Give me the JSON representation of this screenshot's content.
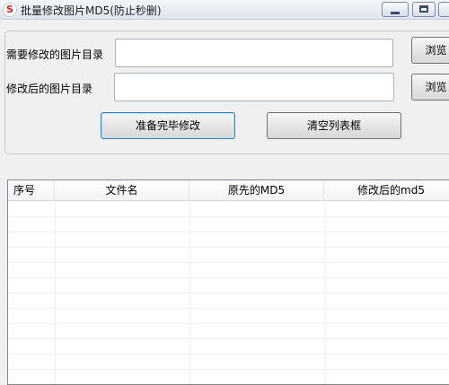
{
  "window": {
    "title": "批量修改图片MD5(防止秒删)",
    "icon_glyph": "S"
  },
  "form": {
    "source_dir_label": "需要修改的图片目录",
    "source_dir_value": "",
    "output_dir_label": "修改后的图片目录",
    "output_dir_value": "",
    "browse_label_1": "浏览",
    "browse_label_2": "浏览",
    "start_button": "准备完毕修改",
    "clear_button": "清空列表框"
  },
  "list": {
    "columns": [
      "序号",
      "文件名",
      "原先的MD5",
      "修改后的md5"
    ],
    "rows": []
  },
  "colors": {
    "window_bg": "#f0f0f0",
    "button_focus_border": "#3c7fb1"
  }
}
